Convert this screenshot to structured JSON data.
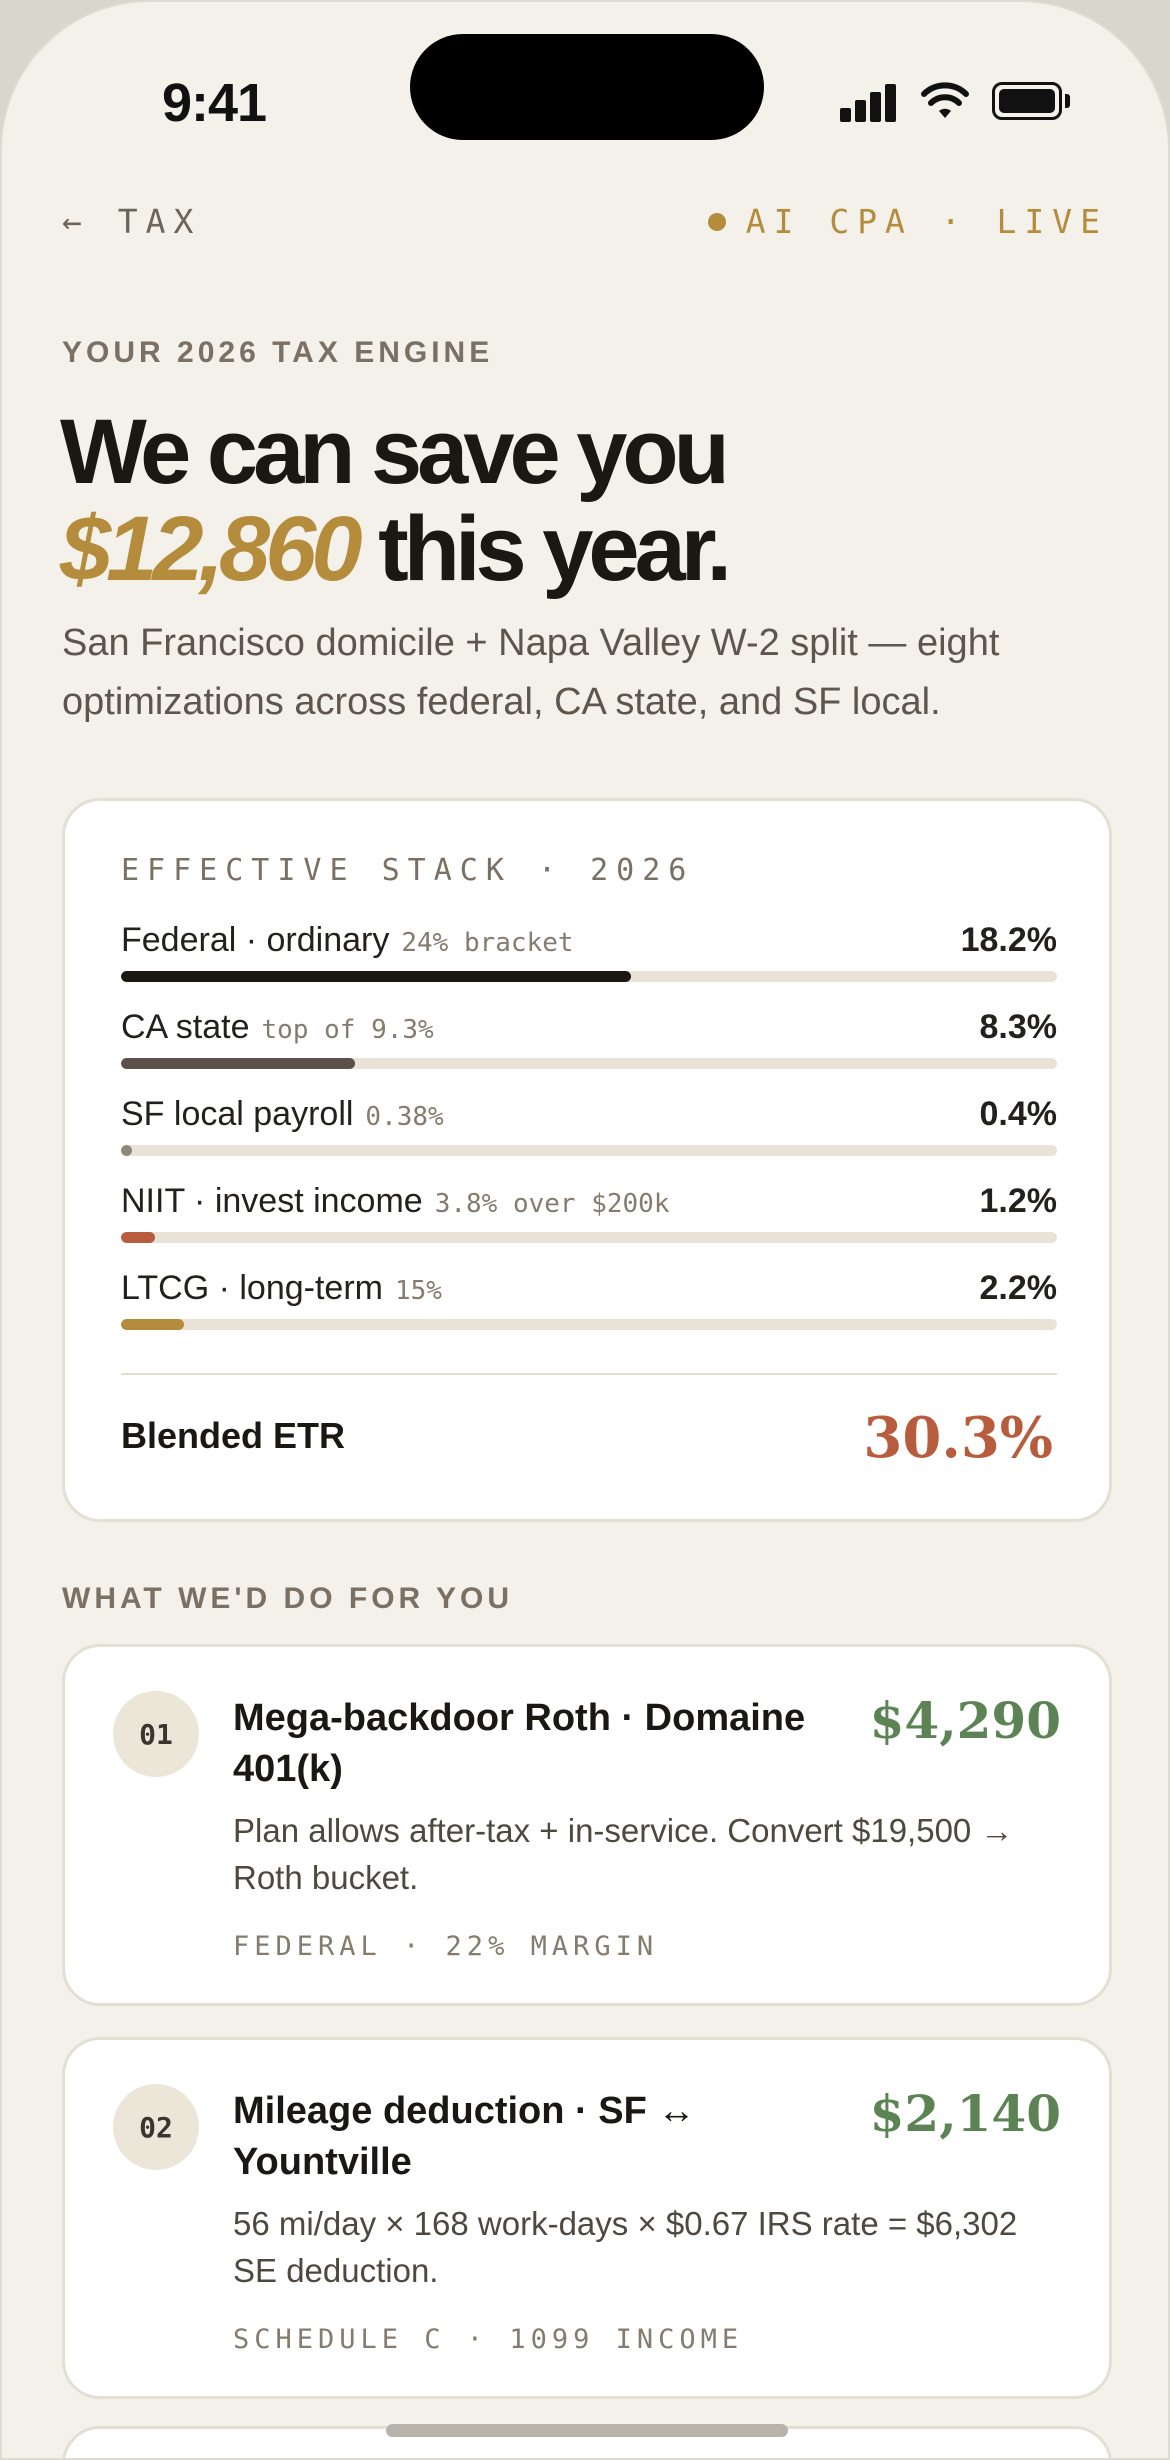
{
  "status_bar": {
    "time": "9:41"
  },
  "nav": {
    "back_label": "← TAX",
    "live_label": "AI CPA · LIVE"
  },
  "hero": {
    "eyebrow": "YOUR 2026 TAX ENGINE",
    "line1": "We can save you",
    "amount": "$12,860",
    "line2_rest": "this year.",
    "subtitle": "San Francisco domicile + Napa Valley W-2 split — eight optimizations across federal, CA state, and SF local."
  },
  "stack": {
    "title": "EFFECTIVE STACK · 2026",
    "rows": [
      {
        "label": "Federal · ordinary",
        "note": "24% bracket",
        "pct": "18.2%",
        "fill": 0.545,
        "color": "#1b1814"
      },
      {
        "label": "CA state",
        "note": "top of 9.3%",
        "pct": "8.3%",
        "fill": 0.25,
        "color": "#5a524a"
      },
      {
        "label": "SF local payroll",
        "note": "0.38%",
        "pct": "0.4%",
        "fill": 0.012,
        "color": "#8f877c"
      },
      {
        "label": "NIIT · invest income",
        "note": "3.8% over $200k",
        "pct": "1.2%",
        "fill": 0.036,
        "color": "#b85c3e"
      },
      {
        "label": "LTCG · long-term",
        "note": "15%",
        "pct": "2.2%",
        "fill": 0.067,
        "color": "#b48c3c"
      }
    ],
    "etr_label": "Blended ETR",
    "etr_value": "30.3%"
  },
  "section_label": "WHAT WE'D DO FOR YOU",
  "optimizations": [
    {
      "num": "01",
      "title": "Mega-backdoor Roth · Domaine 401(k)",
      "amount": "$4,290",
      "desc": "Plan allows after-tax + in-service. Convert $19,500 → Roth bucket.",
      "tag": "FEDERAL · 22% MARGIN"
    },
    {
      "num": "02",
      "title": "Mileage deduction · SF ↔ Yountville",
      "amount": "$2,140",
      "desc": "56 mi/day × 168 work-days × $0.67 IRS rate = $6,302 SE deduction.",
      "tag": "SCHEDULE C · 1099 INCOME"
    }
  ],
  "colors": {
    "gold": "#b48c3c",
    "rust": "#b85c3e",
    "green": "#5c8354",
    "background": "#f3f1ea"
  }
}
